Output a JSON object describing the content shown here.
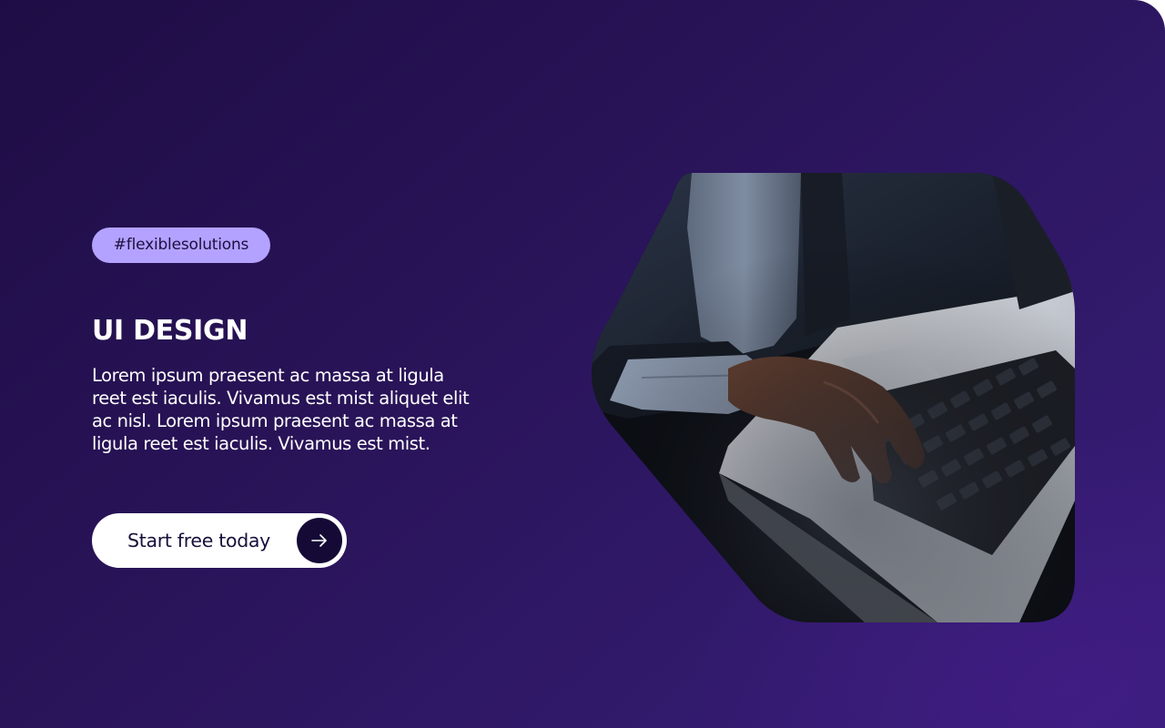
{
  "hero": {
    "tag": "#flexiblesolutions",
    "title": "UI DESIGN",
    "description": "Lorem ipsum praesent ac massa at ligula reet est iaculis. Vivamus est mist aliquet elit ac nisl. Lorem ipsum praesent ac massa at ligula reet est iaculis. Vivamus est mist.",
    "cta_label": "Start free today",
    "cta_icon": "arrow-right-icon",
    "image_subject": "hands typing on laptop keyboard"
  },
  "colors": {
    "background_dark": "#1e0d45",
    "background_light": "#391c7a",
    "tag_background": "#b3a2ff",
    "button_background": "#ffffff",
    "button_icon_background": "#150a36"
  }
}
